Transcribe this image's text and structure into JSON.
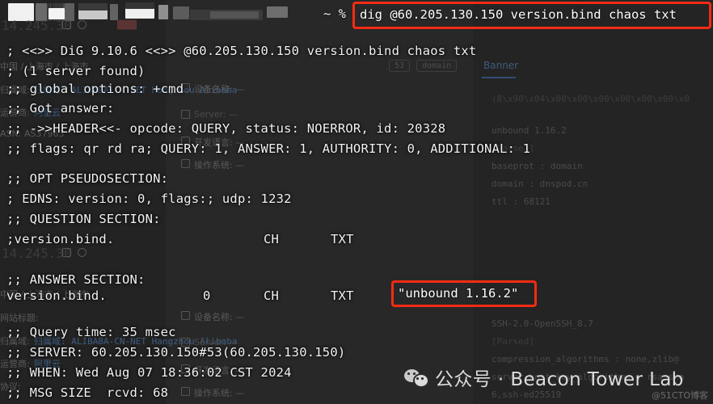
{
  "window": {
    "prompt": "~ %",
    "title_redacted": true
  },
  "command": {
    "text": "dig @60.205.130.150 version.bind chaos txt",
    "highlight_color": "#f42c14"
  },
  "terminal": {
    "background": "#262626",
    "text_color": "#f2f2f2",
    "lines": [
      "; <<>> DiG 9.10.6 <<>> @60.205.130.150 version.bind chaos txt",
      "; (1 server found)",
      ";; global options: +cmd",
      ";; Got answer:",
      ";; ->>HEADER<<- opcode: QUERY, status: NOERROR, id: 20328",
      ";; flags: qr rd ra; QUERY: 1, ANSWER: 1, AUTHORITY: 0, ADDITIONAL: 1",
      "",
      ";; OPT PSEUDOSECTION:",
      "; EDNS: version: 0, flags:; udp: 1232",
      ";; QUESTION SECTION:",
      ";version.bind.\t\t\tCH\tTXT",
      "",
      ";; ANSWER SECTION:",
      "version.bind.\t\t0\tCH\tTXT",
      "",
      ";; Query time: 35 msec",
      ";; SERVER: 60.205.130.150#53(60.205.130.150)",
      ";; WHEN: Wed Aug 07 18:36:02 CST 2024",
      ";; MSG SIZE  rcvd: 68"
    ],
    "question_row": {
      "name": ";version.bind.",
      "class": "CH",
      "type": "TXT"
    },
    "answer_row": {
      "name": "version.bind.",
      "ttl": "0",
      "class": "CH",
      "type": "TXT",
      "value": "\"unbound 1.16.2\""
    }
  },
  "background_page": {
    "badges": [
      "53",
      "domain"
    ],
    "tab": "Banner",
    "right_column": [
      "(8\\x90\\x04\\x00\\x00\\x00\\x00\\x00\\x00\\x0",
      "unbound 1.16.2",
      "[Parsed]",
      "baseprot : domain",
      "domain : dnspod.cn",
      "ttl : 68121",
      "SSH-2.0-OpenSSH_8.7",
      "[Parsed]",
      "compression_algorithms : none,zlib@",
      "server_host_key_algorithms : rsa-sha",
      "6,ssh-ed25519"
    ],
    "left_column": [
      "14.245.30",
      "中国 / 上海市 / 上海市",
      "网站标题:",
      "运营商: 阿里云",
      "归属域: ALIBABA-CN-NET Hangzhou Alibaba",
      "ASN: AS37963"
    ],
    "mid_column": [
      "设备名称: —",
      "Server: —",
      "开发语言: —",
      "操作系统: —"
    ]
  },
  "watermark": {
    "icon": "wechat-icon",
    "text": "公众号 · Beacon Tower Lab",
    "credit": "@51CTO博客"
  }
}
